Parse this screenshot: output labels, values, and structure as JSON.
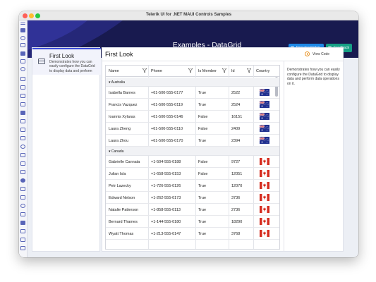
{
  "window": {
    "title": "Telerik UI for .NET MAUI Controls Samples"
  },
  "header": {
    "title": "Examples - DataGrid",
    "documentation_label": "Documentation",
    "feedback_label": "Feedback"
  },
  "colors": {
    "header_bg": "#181a4f",
    "documentation_btn": "#1e88e5",
    "feedback_btn": "#16a085",
    "accent": "#3c4bd8"
  },
  "example_card": {
    "title": "First Look",
    "description": "Demonstrates how you can easily configure the DataGrid to display data and perform"
  },
  "main": {
    "title": "First Look",
    "view_code_label": "View Code",
    "description": "Demonstrates how you can easily configure the DataGrid to display data and perform data operations on it."
  },
  "grid": {
    "columns": [
      "Name",
      "Phone",
      "Is Member",
      "Id",
      "Country"
    ],
    "groups": [
      {
        "label": "Australia",
        "flag": "australia",
        "rows": [
          [
            "Isabella Barnes",
            "+61-500-555-0177",
            "True",
            "2522"
          ],
          [
            "Francis Vazquez",
            "+61-500-555-0119",
            "True",
            "2524"
          ],
          [
            "Ioannis Xylaras",
            "+61-500-555-0146",
            "False",
            "16151"
          ],
          [
            "Laura Zheng",
            "+61-500-555-0110",
            "False",
            "2409"
          ],
          [
            "Laura Zhou",
            "+61-500-555-0170",
            "True",
            "2394"
          ]
        ]
      },
      {
        "label": "Canada",
        "flag": "canada",
        "rows": [
          [
            "Gabrielle Cannata",
            "+1-504-555-0188",
            "False",
            "9727"
          ],
          [
            "Julian Isla",
            "+1-658-555-0153",
            "False",
            "12051"
          ],
          [
            "Petr Lazecky",
            "+1-726-555-0126",
            "True",
            "12070"
          ],
          [
            "Edward Nelson",
            "+1-262-555-0173",
            "True",
            "3736"
          ],
          [
            "Natalie Patterson",
            "+1-858-555-0113",
            "True",
            "2736"
          ],
          [
            "Bernard Thames",
            "+1-144-555-0180",
            "True",
            "18290"
          ],
          [
            "Wyatt Thomas",
            "+1-213-555-0147",
            "True",
            "3768"
          ]
        ]
      }
    ]
  }
}
